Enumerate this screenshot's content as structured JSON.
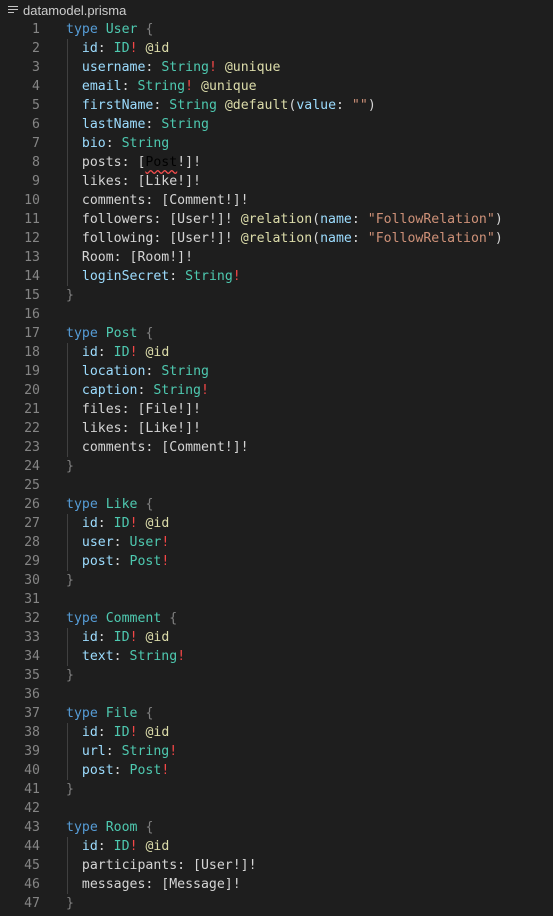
{
  "breadcrumb": {
    "filename": "datamodel.prisma",
    "icon": "lines-icon"
  },
  "colors": {
    "background": "#1e1e1e",
    "keyword": "#569cd6",
    "type_name": "#4ec9b0",
    "field": "#9cdcfe",
    "directive": "#dcdcaa",
    "string": "#ce9178",
    "bang": "#f44747",
    "line_number": "#858585"
  },
  "lines": [
    {
      "n": "1",
      "tokens": [
        [
          "kw",
          "type"
        ],
        [
          "pn",
          " "
        ],
        [
          "tn",
          "User"
        ],
        [
          "pn",
          " "
        ],
        [
          "br",
          "{"
        ]
      ]
    },
    {
      "n": "2",
      "tokens": [
        [
          "fd",
          "id"
        ],
        [
          "pn",
          ": "
        ],
        [
          "tn",
          "ID"
        ],
        [
          "bang",
          "!"
        ],
        [
          "pn",
          " "
        ],
        [
          "dir",
          "@id"
        ]
      ]
    },
    {
      "n": "3",
      "tokens": [
        [
          "fd",
          "username"
        ],
        [
          "pn",
          ": "
        ],
        [
          "tn",
          "String"
        ],
        [
          "bang",
          "!"
        ],
        [
          "pn",
          " "
        ],
        [
          "dir",
          "@unique"
        ]
      ]
    },
    {
      "n": "4",
      "tokens": [
        [
          "fd",
          "email"
        ],
        [
          "pn",
          ": "
        ],
        [
          "tn",
          "String"
        ],
        [
          "bang",
          "!"
        ],
        [
          "pn",
          " "
        ],
        [
          "dir",
          "@unique"
        ]
      ]
    },
    {
      "n": "5",
      "tokens": [
        [
          "fd",
          "firstName"
        ],
        [
          "pn",
          ": "
        ],
        [
          "tn",
          "String"
        ],
        [
          "pn",
          " "
        ],
        [
          "dir",
          "@default"
        ],
        [
          "pn",
          "("
        ],
        [
          "par",
          "value"
        ],
        [
          "pn",
          ": "
        ],
        [
          "str",
          "\"\""
        ],
        [
          "pn",
          ")"
        ]
      ]
    },
    {
      "n": "6",
      "tokens": [
        [
          "fd",
          "lastName"
        ],
        [
          "pn",
          ": "
        ],
        [
          "tn",
          "String"
        ]
      ]
    },
    {
      "n": "7",
      "tokens": [
        [
          "fd",
          "bio"
        ],
        [
          "pn",
          ": "
        ],
        [
          "tn",
          "String"
        ]
      ]
    },
    {
      "n": "8",
      "tokens": [
        [
          "pn",
          "posts: ["
        ],
        [
          "squig",
          "Post"
        ],
        [
          "pn",
          "!]!"
        ]
      ]
    },
    {
      "n": "9",
      "tokens": [
        [
          "pn",
          "likes: [Like!]!"
        ]
      ]
    },
    {
      "n": "10",
      "tokens": [
        [
          "pn",
          "comments: [Comment!]!"
        ]
      ]
    },
    {
      "n": "11",
      "tokens": [
        [
          "pn",
          "followers: [User!]! "
        ],
        [
          "dir",
          "@relation"
        ],
        [
          "pn",
          "("
        ],
        [
          "par",
          "name"
        ],
        [
          "pn",
          ": "
        ],
        [
          "str",
          "\"FollowRelation\""
        ],
        [
          "pn",
          ")"
        ]
      ]
    },
    {
      "n": "12",
      "tokens": [
        [
          "pn",
          "following: [User!]! "
        ],
        [
          "dir",
          "@relation"
        ],
        [
          "pn",
          "("
        ],
        [
          "par",
          "name"
        ],
        [
          "pn",
          ": "
        ],
        [
          "str",
          "\"FollowRelation\""
        ],
        [
          "pn",
          ")"
        ]
      ]
    },
    {
      "n": "13",
      "tokens": [
        [
          "pn",
          "Room: [Room!]!"
        ]
      ]
    },
    {
      "n": "14",
      "tokens": [
        [
          "fd",
          "loginSecret"
        ],
        [
          "pn",
          ": "
        ],
        [
          "tn",
          "String"
        ],
        [
          "bang",
          "!"
        ]
      ]
    },
    {
      "n": "15",
      "tokens": [
        [
          "br",
          "}"
        ]
      ]
    },
    {
      "n": "16",
      "tokens": []
    },
    {
      "n": "17",
      "tokens": [
        [
          "kw",
          "type"
        ],
        [
          "pn",
          " "
        ],
        [
          "tn",
          "Post"
        ],
        [
          "pn",
          " "
        ],
        [
          "br",
          "{"
        ]
      ]
    },
    {
      "n": "18",
      "tokens": [
        [
          "fd",
          "id"
        ],
        [
          "pn",
          ": "
        ],
        [
          "tn",
          "ID"
        ],
        [
          "bang",
          "!"
        ],
        [
          "pn",
          " "
        ],
        [
          "dir",
          "@id"
        ]
      ]
    },
    {
      "n": "19",
      "tokens": [
        [
          "fd",
          "location"
        ],
        [
          "pn",
          ": "
        ],
        [
          "tn",
          "String"
        ]
      ]
    },
    {
      "n": "20",
      "tokens": [
        [
          "fd",
          "caption"
        ],
        [
          "pn",
          ": "
        ],
        [
          "tn",
          "String"
        ],
        [
          "bang",
          "!"
        ]
      ]
    },
    {
      "n": "21",
      "tokens": [
        [
          "pn",
          "files: [File!]!"
        ]
      ]
    },
    {
      "n": "22",
      "tokens": [
        [
          "pn",
          "likes: [Like!]!"
        ]
      ]
    },
    {
      "n": "23",
      "tokens": [
        [
          "pn",
          "comments: [Comment!]!"
        ]
      ]
    },
    {
      "n": "24",
      "tokens": [
        [
          "br",
          "}"
        ]
      ]
    },
    {
      "n": "25",
      "tokens": []
    },
    {
      "n": "26",
      "tokens": [
        [
          "kw",
          "type"
        ],
        [
          "pn",
          " "
        ],
        [
          "tn",
          "Like"
        ],
        [
          "pn",
          " "
        ],
        [
          "br",
          "{"
        ]
      ]
    },
    {
      "n": "27",
      "tokens": [
        [
          "fd",
          "id"
        ],
        [
          "pn",
          ": "
        ],
        [
          "tn",
          "ID"
        ],
        [
          "bang",
          "!"
        ],
        [
          "pn",
          " "
        ],
        [
          "dir",
          "@id"
        ]
      ]
    },
    {
      "n": "28",
      "tokens": [
        [
          "fd",
          "user"
        ],
        [
          "pn",
          ": "
        ],
        [
          "tn",
          "User"
        ],
        [
          "bang",
          "!"
        ]
      ]
    },
    {
      "n": "29",
      "tokens": [
        [
          "fd",
          "post"
        ],
        [
          "pn",
          ": "
        ],
        [
          "tn",
          "Post"
        ],
        [
          "bang",
          "!"
        ]
      ]
    },
    {
      "n": "30",
      "tokens": [
        [
          "br",
          "}"
        ]
      ]
    },
    {
      "n": "31",
      "tokens": []
    },
    {
      "n": "32",
      "tokens": [
        [
          "kw",
          "type"
        ],
        [
          "pn",
          " "
        ],
        [
          "tn",
          "Comment"
        ],
        [
          "pn",
          " "
        ],
        [
          "br",
          "{"
        ]
      ]
    },
    {
      "n": "33",
      "tokens": [
        [
          "fd",
          "id"
        ],
        [
          "pn",
          ": "
        ],
        [
          "tn",
          "ID"
        ],
        [
          "bang",
          "!"
        ],
        [
          "pn",
          " "
        ],
        [
          "dir",
          "@id"
        ]
      ]
    },
    {
      "n": "34",
      "tokens": [
        [
          "fd",
          "text"
        ],
        [
          "pn",
          ": "
        ],
        [
          "tn",
          "String"
        ],
        [
          "bang",
          "!"
        ]
      ]
    },
    {
      "n": "35",
      "tokens": [
        [
          "br",
          "}"
        ]
      ]
    },
    {
      "n": "36",
      "tokens": []
    },
    {
      "n": "37",
      "tokens": [
        [
          "kw",
          "type"
        ],
        [
          "pn",
          " "
        ],
        [
          "tn",
          "File"
        ],
        [
          "pn",
          " "
        ],
        [
          "br",
          "{"
        ]
      ]
    },
    {
      "n": "38",
      "tokens": [
        [
          "fd",
          "id"
        ],
        [
          "pn",
          ": "
        ],
        [
          "tn",
          "ID"
        ],
        [
          "bang",
          "!"
        ],
        [
          "pn",
          " "
        ],
        [
          "dir",
          "@id"
        ]
      ]
    },
    {
      "n": "39",
      "tokens": [
        [
          "fd",
          "url"
        ],
        [
          "pn",
          ": "
        ],
        [
          "tn",
          "String"
        ],
        [
          "bang",
          "!"
        ]
      ]
    },
    {
      "n": "40",
      "tokens": [
        [
          "fd",
          "post"
        ],
        [
          "pn",
          ": "
        ],
        [
          "tn",
          "Post"
        ],
        [
          "bang",
          "!"
        ]
      ]
    },
    {
      "n": "41",
      "tokens": [
        [
          "br",
          "}"
        ]
      ]
    },
    {
      "n": "42",
      "tokens": []
    },
    {
      "n": "43",
      "tokens": [
        [
          "kw",
          "type"
        ],
        [
          "pn",
          " "
        ],
        [
          "tn",
          "Room"
        ],
        [
          "pn",
          " "
        ],
        [
          "br",
          "{"
        ]
      ]
    },
    {
      "n": "44",
      "tokens": [
        [
          "fd",
          "id"
        ],
        [
          "pn",
          ": "
        ],
        [
          "tn",
          "ID"
        ],
        [
          "bang",
          "!"
        ],
        [
          "pn",
          " "
        ],
        [
          "dir",
          "@id"
        ]
      ]
    },
    {
      "n": "45",
      "tokens": [
        [
          "pn",
          "participants: [User!]!"
        ]
      ]
    },
    {
      "n": "46",
      "tokens": [
        [
          "pn",
          "messages: [Message]!"
        ]
      ]
    },
    {
      "n": "47",
      "tokens": [
        [
          "br",
          "}"
        ]
      ]
    }
  ]
}
